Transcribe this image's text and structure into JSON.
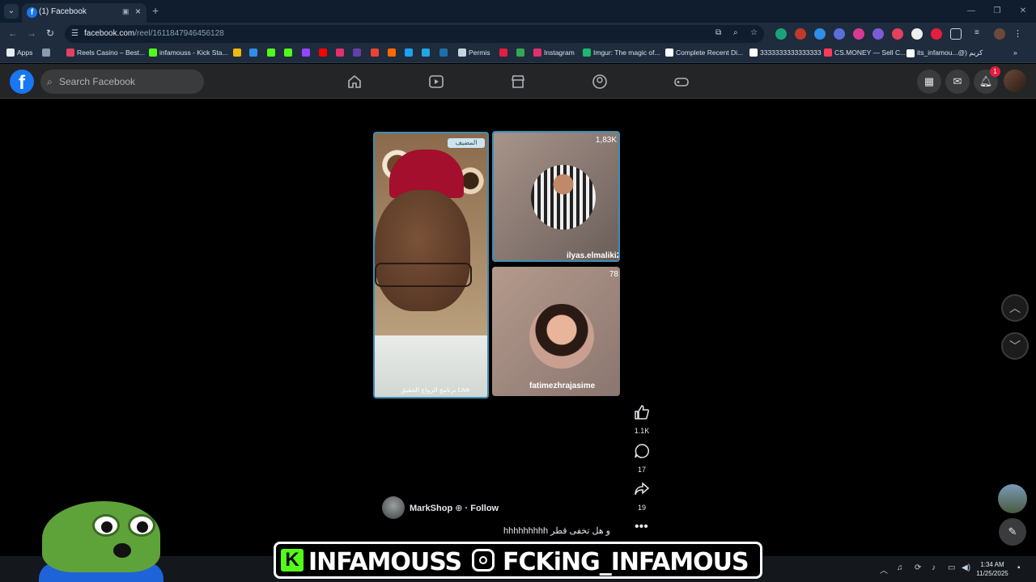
{
  "browser": {
    "tab_title": "(1) Facebook",
    "new_tab_label": "+",
    "url_host": "facebook.com",
    "url_path": "/reel/1611847946456128",
    "bookmarks": [
      {
        "label": "Apps",
        "color": "#e6edf5"
      },
      {
        "label": "",
        "color": "#8a9bb0"
      },
      {
        "label": "Reels Casino – Best...",
        "color": "#e4405f"
      },
      {
        "label": "infamouss - Kick Sta...",
        "color": "#53fc18"
      },
      {
        "label": "",
        "color": "#f0b90b"
      },
      {
        "label": "",
        "color": "#2f8ee8"
      },
      {
        "label": "",
        "color": "#53fc18"
      },
      {
        "label": "",
        "color": "#53fc18"
      },
      {
        "label": "",
        "color": "#9146ff"
      },
      {
        "label": "",
        "color": "#ff0000"
      },
      {
        "label": "",
        "color": "#e1306c"
      },
      {
        "label": "",
        "color": "#6441a5"
      },
      {
        "label": "",
        "color": "#ea4335"
      },
      {
        "label": "",
        "color": "#ff6a00"
      },
      {
        "label": "",
        "color": "#1da1f2"
      },
      {
        "label": "",
        "color": "#26a5e4"
      },
      {
        "label": "",
        "color": "#1e6fa8"
      },
      {
        "label": "Permis",
        "color": "#c7d3e1"
      },
      {
        "label": "",
        "color": "#e41e3f"
      },
      {
        "label": "",
        "color": "#34a853"
      },
      {
        "label": "Instagram",
        "color": "#e1306c"
      },
      {
        "label": "Imgur: The magic of...",
        "color": "#1bb76e"
      },
      {
        "label": "Complete Recent Di...",
        "color": "#ffffff"
      },
      {
        "label": "3333333333333333",
        "color": "#ffffff"
      },
      {
        "label": "CS.MONEY — Sell C...",
        "color": "#ff3b5c"
      },
      {
        "label": "its_infamou...@) كريم",
        "color": "#ffffff"
      }
    ]
  },
  "facebook": {
    "search_placeholder": "Search Facebook",
    "notification_count": "1"
  },
  "reel": {
    "host_badge": "المضيف",
    "host_caption": "برنامج الزواج الحقيق Live",
    "guest1_count": "1,83K",
    "guest1_name": "ilyas.elmaliki2",
    "guest2_count": "78",
    "guest2_name": "fatimezhrajasime",
    "likes": "1.1K",
    "comments": "17",
    "shares": "19",
    "author": "MarkShop",
    "follow_label": "Follow",
    "caption": "hhhhhhhhh و هل تخفى قطر"
  },
  "taskbar": {
    "time": "1:34 AM",
    "date": "11/25/2025"
  },
  "overlay": {
    "handle_kick": "INFAMOUSS",
    "handle_ig": "FCKiNG_INFAMOUS",
    "kick_logo": "K"
  }
}
